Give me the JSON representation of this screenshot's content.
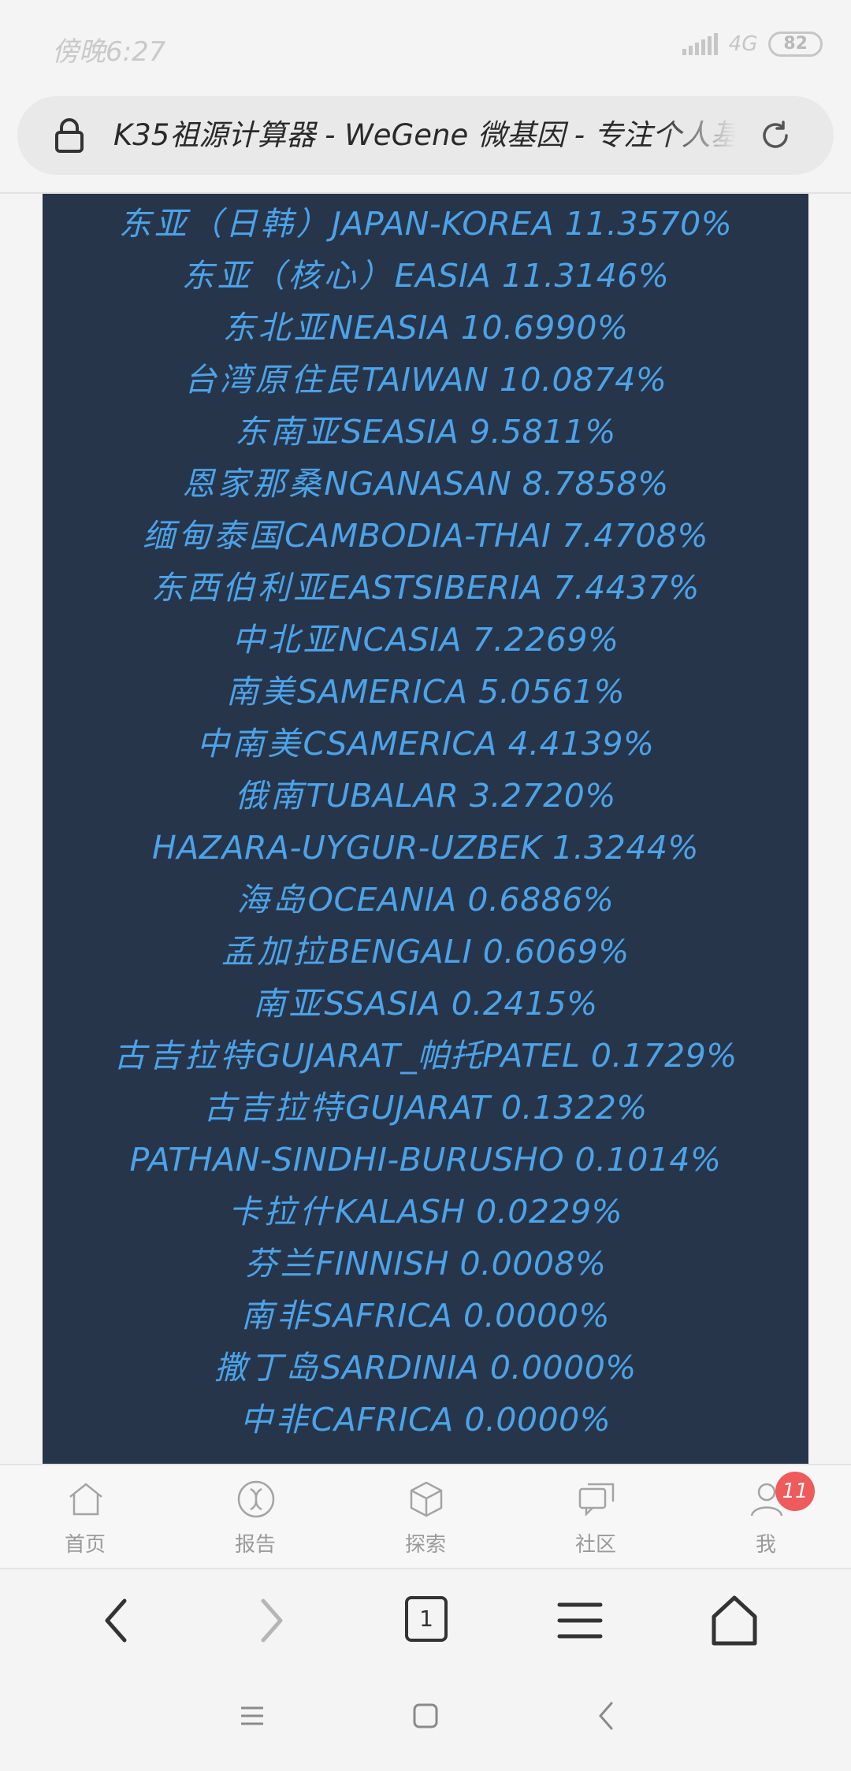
{
  "status": {
    "time": "傍晚6:27",
    "network": "4G",
    "battery": "82"
  },
  "browser": {
    "url_title": "K35祖源计算器 - WeGene 微基因 - 专注个人基因"
  },
  "results": [
    {
      "name": "东亚（日韩）",
      "code": "JAPAN-KOREA",
      "pct": "11.3570%"
    },
    {
      "name": "东亚（核心）",
      "code": "EASIA",
      "pct": "11.3146%"
    },
    {
      "name": "东北亚",
      "code": "NEASIA",
      "pct": "10.6990%"
    },
    {
      "name": "台湾原住民",
      "code": "TAIWAN",
      "pct": "10.0874%"
    },
    {
      "name": "东南亚",
      "code": "SEASIA",
      "pct": "9.5811%"
    },
    {
      "name": "恩家那桑",
      "code": "NGANASAN",
      "pct": "8.7858%"
    },
    {
      "name": "缅甸泰国",
      "code": "CAMBODIA-THAI",
      "pct": "7.4708%"
    },
    {
      "name": "东西伯利亚",
      "code": "EASTSIBERIA",
      "pct": "7.4437%"
    },
    {
      "name": "中北亚",
      "code": "NCASIA",
      "pct": "7.2269%"
    },
    {
      "name": "南美",
      "code": "SAMERICA",
      "pct": "5.0561%"
    },
    {
      "name": "中南美",
      "code": "CSAMERICA",
      "pct": "4.4139%"
    },
    {
      "name": "俄南",
      "code": "TUBALAR",
      "pct": "3.2720%"
    },
    {
      "name": "",
      "code": "HAZARA-UYGUR-UZBEK",
      "pct": "1.3244%"
    },
    {
      "name": "海岛",
      "code": "OCEANIA",
      "pct": "0.6886%"
    },
    {
      "name": "孟加拉",
      "code": "BENGALI",
      "pct": "0.6069%"
    },
    {
      "name": "南亚",
      "code": "SSASIA",
      "pct": "0.2415%"
    },
    {
      "name": "古吉拉特",
      "code": "GUJARAT_帕托PATEL",
      "pct": "0.1729%"
    },
    {
      "name": "古吉拉特",
      "code": "GUJARAT",
      "pct": "0.1322%"
    },
    {
      "name": "",
      "code": "PATHAN-SINDHI-BURUSHO",
      "pct": "0.1014%"
    },
    {
      "name": "卡拉什",
      "code": "KALASH",
      "pct": "0.0229%"
    },
    {
      "name": "芬兰",
      "code": "FINNISH",
      "pct": "0.0008%"
    },
    {
      "name": "南非",
      "code": "SAFRICA",
      "pct": "0.0000%"
    },
    {
      "name": "撒丁岛",
      "code": "SARDINIA",
      "pct": "0.0000%"
    },
    {
      "name": "中非",
      "code": "CAFRICA",
      "pct": "0.0000%"
    }
  ],
  "bottom_nav": [
    {
      "label": "首页",
      "icon": "home-icon"
    },
    {
      "label": "报告",
      "icon": "dna-icon"
    },
    {
      "label": "探索",
      "icon": "cube-icon"
    },
    {
      "label": "社区",
      "icon": "chat-icon"
    },
    {
      "label": "我",
      "icon": "person-icon",
      "badge": "11"
    }
  ],
  "browser_toolbar": {
    "tab_count": "1"
  },
  "colors": {
    "content_bg": "#27354b",
    "result_text": "#4ca3e8",
    "badge": "#ef5a5a"
  }
}
